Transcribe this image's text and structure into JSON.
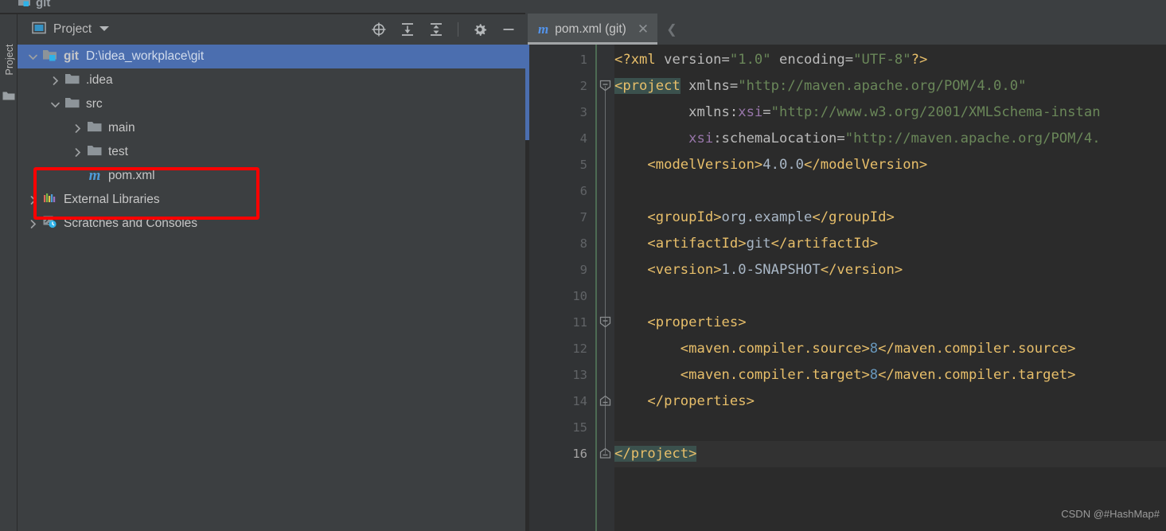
{
  "topbar": {
    "breadcrumb": "git"
  },
  "leftbar": {
    "tool_window": "Project",
    "folder_icon": "folder-icon"
  },
  "project_panel": {
    "title": "Project",
    "dropdown_icon": "chevron-down-icon",
    "actions": [
      {
        "name": "locate-in-tree-icon",
        "label": "Select Opened File"
      },
      {
        "name": "expand-all-icon",
        "label": "Expand All"
      },
      {
        "name": "collapse-all-icon",
        "label": "Collapse All"
      },
      {
        "name": "settings-gear-icon",
        "label": "Settings"
      },
      {
        "name": "minimize-icon",
        "label": "Hide"
      }
    ],
    "tree": [
      {
        "label": "git",
        "path": "D:\\idea_workplace\\git",
        "icon": "module-folder-icon",
        "arrow": "expanded",
        "indent": 0,
        "selected": true,
        "bold": true
      },
      {
        "label": ".idea",
        "path": "",
        "icon": "folder-icon",
        "arrow": "collapsed",
        "indent": 1,
        "selected": false,
        "bold": false
      },
      {
        "label": "src",
        "path": "",
        "icon": "folder-icon",
        "arrow": "expanded",
        "indent": 1,
        "selected": false,
        "bold": false
      },
      {
        "label": "main",
        "path": "",
        "icon": "folder-icon",
        "arrow": "collapsed",
        "indent": 2,
        "selected": false,
        "bold": false
      },
      {
        "label": "test",
        "path": "",
        "icon": "folder-icon",
        "arrow": "collapsed",
        "indent": 2,
        "selected": false,
        "bold": false
      },
      {
        "label": "pom.xml",
        "path": "",
        "icon": "maven-m-icon",
        "arrow": "none",
        "indent": 2,
        "selected": false,
        "bold": false
      },
      {
        "label": "External Libraries",
        "path": "",
        "icon": "libraries-icon",
        "arrow": "collapsed",
        "indent": 0,
        "selected": false,
        "bold": false
      },
      {
        "label": "Scratches and Consoles",
        "path": "",
        "icon": "scratches-icon",
        "arrow": "collapsed",
        "indent": 0,
        "selected": false,
        "bold": false
      }
    ],
    "annotation": {
      "shape": "rectangle",
      "color": "#fe0000",
      "targets": "pom.xml"
    }
  },
  "editor": {
    "tab": {
      "label": "pom.xml (git)",
      "file_icon": "maven-m-icon",
      "close_icon": "close-icon"
    },
    "scroll_left_icon": "chevron-left-icon",
    "line_numbers": [
      1,
      2,
      3,
      4,
      5,
      6,
      7,
      8,
      9,
      10,
      11,
      12,
      13,
      14,
      15,
      16
    ],
    "current_line": 16,
    "lines": [
      {
        "n": 1,
        "segments": [
          {
            "t": "<?xml ",
            "c": "t-pi"
          },
          {
            "t": "version",
            "c": "t-attr"
          },
          {
            "t": "=",
            "c": "t-eq"
          },
          {
            "t": "\"1.0\"",
            "c": "t-str"
          },
          {
            "t": " ",
            "c": "t-txt"
          },
          {
            "t": "encoding",
            "c": "t-attr"
          },
          {
            "t": "=",
            "c": "t-eq"
          },
          {
            "t": "\"UTF-8\"",
            "c": "t-str"
          },
          {
            "t": "?>",
            "c": "t-pi"
          }
        ]
      },
      {
        "n": 2,
        "segments": [
          {
            "t": "<project",
            "c": "t-tag hl-match"
          },
          {
            "t": " ",
            "c": "t-txt"
          },
          {
            "t": "xmlns",
            "c": "t-attr"
          },
          {
            "t": "=",
            "c": "t-eq"
          },
          {
            "t": "\"http://maven.apache.org/POM/4.0.0\"",
            "c": "t-str"
          }
        ]
      },
      {
        "n": 3,
        "segments": [
          {
            "t": "         ",
            "c": "t-txt"
          },
          {
            "t": "xmlns:",
            "c": "t-attr"
          },
          {
            "t": "xsi",
            "c": "t-nsx"
          },
          {
            "t": "=",
            "c": "t-eq"
          },
          {
            "t": "\"http://www.w3.org/2001/XMLSchema-instan",
            "c": "t-str"
          }
        ]
      },
      {
        "n": 4,
        "segments": [
          {
            "t": "         ",
            "c": "t-txt"
          },
          {
            "t": "xsi",
            "c": "t-nsx"
          },
          {
            "t": ":schemaLocation",
            "c": "t-attr"
          },
          {
            "t": "=",
            "c": "t-eq"
          },
          {
            "t": "\"http://maven.apache.org/POM/4.",
            "c": "t-str"
          }
        ]
      },
      {
        "n": 5,
        "segments": [
          {
            "t": "    ",
            "c": "t-txt"
          },
          {
            "t": "<modelVersion>",
            "c": "t-tag"
          },
          {
            "t": "4.0.0",
            "c": "t-txt"
          },
          {
            "t": "</modelVersion>",
            "c": "t-tag"
          }
        ]
      },
      {
        "n": 6,
        "segments": []
      },
      {
        "n": 7,
        "segments": [
          {
            "t": "    ",
            "c": "t-txt"
          },
          {
            "t": "<groupId>",
            "c": "t-tag"
          },
          {
            "t": "org.example",
            "c": "t-txt"
          },
          {
            "t": "</groupId>",
            "c": "t-tag"
          }
        ]
      },
      {
        "n": 8,
        "segments": [
          {
            "t": "    ",
            "c": "t-txt"
          },
          {
            "t": "<artifactId>",
            "c": "t-tag"
          },
          {
            "t": "git",
            "c": "t-txt"
          },
          {
            "t": "</artifactId>",
            "c": "t-tag"
          }
        ]
      },
      {
        "n": 9,
        "segments": [
          {
            "t": "    ",
            "c": "t-txt"
          },
          {
            "t": "<version>",
            "c": "t-tag"
          },
          {
            "t": "1.0-SNAPSHOT",
            "c": "t-txt"
          },
          {
            "t": "</version>",
            "c": "t-tag"
          }
        ]
      },
      {
        "n": 10,
        "segments": []
      },
      {
        "n": 11,
        "segments": [
          {
            "t": "    ",
            "c": "t-txt"
          },
          {
            "t": "<properties>",
            "c": "t-tag"
          }
        ]
      },
      {
        "n": 12,
        "segments": [
          {
            "t": "        ",
            "c": "t-txt"
          },
          {
            "t": "<maven.compiler.source>",
            "c": "t-tag"
          },
          {
            "t": "8",
            "c": "t-num"
          },
          {
            "t": "</maven.compiler.source>",
            "c": "t-tag"
          }
        ]
      },
      {
        "n": 13,
        "segments": [
          {
            "t": "        ",
            "c": "t-txt"
          },
          {
            "t": "<maven.compiler.target>",
            "c": "t-tag"
          },
          {
            "t": "8",
            "c": "t-num"
          },
          {
            "t": "</maven.compiler.target>",
            "c": "t-tag"
          }
        ]
      },
      {
        "n": 14,
        "segments": [
          {
            "t": "    ",
            "c": "t-txt"
          },
          {
            "t": "</properties>",
            "c": "t-tag"
          }
        ]
      },
      {
        "n": 15,
        "segments": []
      },
      {
        "n": 16,
        "segments": [
          {
            "t": "</project>",
            "c": "t-tag hl-match"
          }
        ]
      }
    ],
    "fold_markers": [
      {
        "line": 2,
        "type": "expanded-start"
      },
      {
        "line": 11,
        "type": "expanded-start"
      },
      {
        "line": 14,
        "type": "expanded-end"
      },
      {
        "line": 16,
        "type": "expanded-end"
      }
    ]
  },
  "watermark": "CSDN @#HashMap#",
  "colors": {
    "panel_bg": "#3c3f41",
    "editor_bg": "#2b2b2b",
    "gutter_bg": "#313335",
    "selection_blue": "#4b6eaf",
    "annotation_red": "#fe0000",
    "tag": "#e8bf6a",
    "string": "#6a8759",
    "number": "#6897bb",
    "text": "#a9b7c6"
  }
}
